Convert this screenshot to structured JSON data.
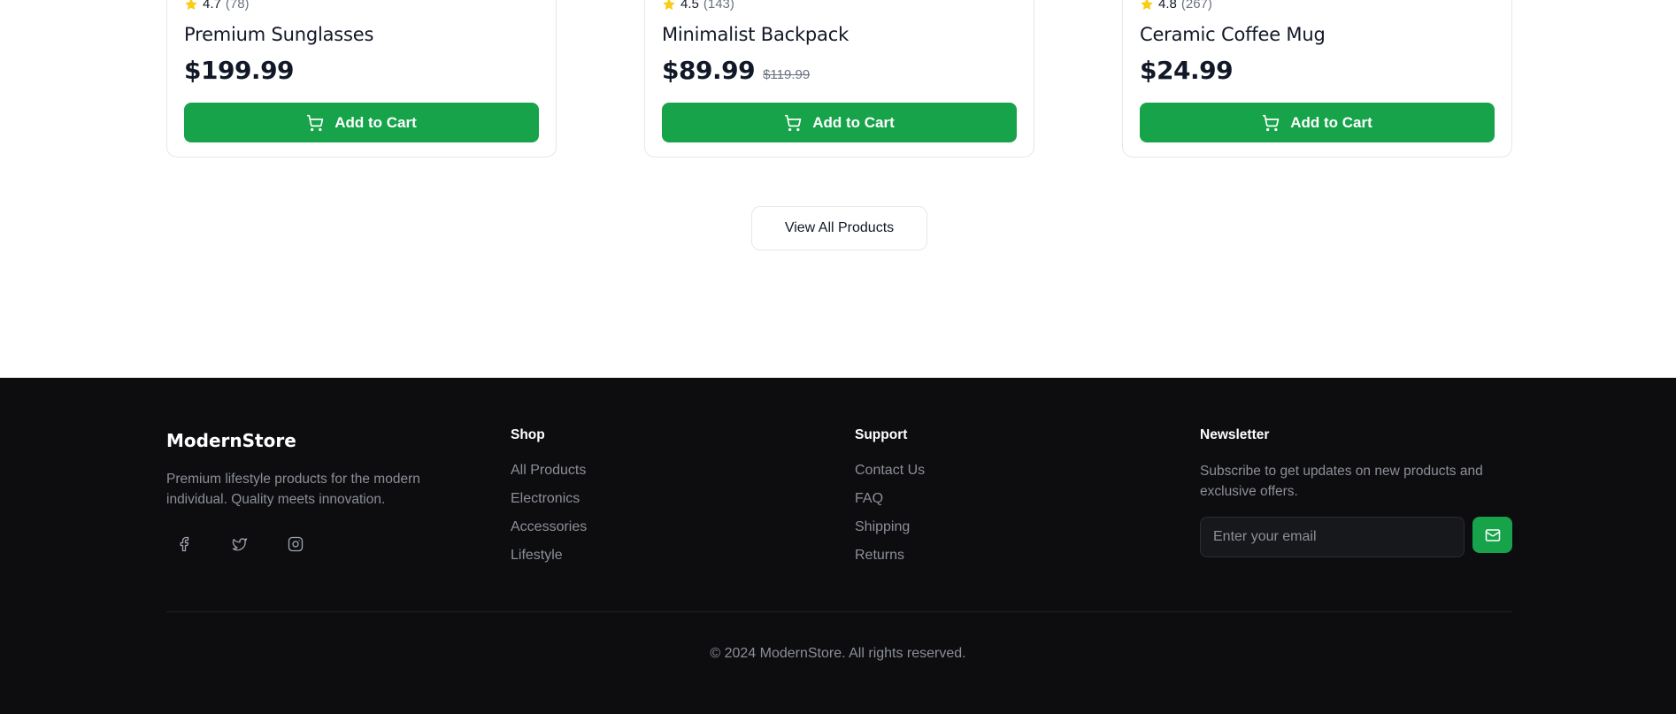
{
  "products": [
    {
      "rating": "4.7",
      "reviews": "(78)",
      "name": "Premium Sunglasses",
      "price": "$199.99",
      "old_price": "",
      "cta": "Add to Cart"
    },
    {
      "rating": "4.5",
      "reviews": "(143)",
      "name": "Minimalist Backpack",
      "price": "$89.99",
      "old_price": "$119.99",
      "cta": "Add to Cart"
    },
    {
      "rating": "4.8",
      "reviews": "(267)",
      "name": "Ceramic Coffee Mug",
      "price": "$24.99",
      "old_price": "",
      "cta": "Add to Cart"
    }
  ],
  "view_all_label": "View All Products",
  "footer": {
    "brand": "ModernStore",
    "brand_description": "Premium lifestyle products for the modern individual. Quality meets innovation.",
    "socials": [
      "facebook-icon",
      "twitter-icon",
      "instagram-icon"
    ],
    "shop": {
      "title": "Shop",
      "links": [
        "All Products",
        "Electronics",
        "Accessories",
        "Lifestyle"
      ]
    },
    "support": {
      "title": "Support",
      "links": [
        "Contact Us",
        "FAQ",
        "Shipping",
        "Returns"
      ]
    },
    "newsletter": {
      "title": "Newsletter",
      "description": "Subscribe to get updates on new products and exclusive offers.",
      "placeholder": "Enter your email",
      "submit_icon": "mail-icon"
    },
    "copyright": "© 2024 ModernStore. All rights reserved."
  },
  "colors": {
    "accent": "#16a34a",
    "star": "#facc15",
    "footer_bg": "#0d0d0f",
    "muted_text": "#8b8f98"
  }
}
